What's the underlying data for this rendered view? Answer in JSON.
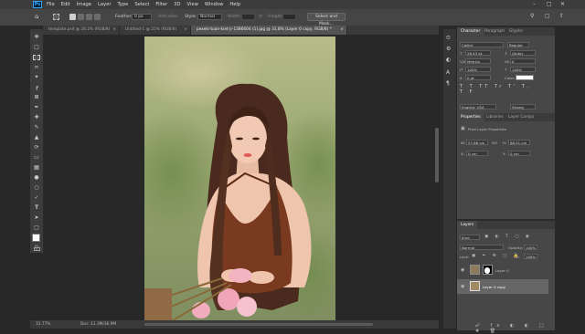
{
  "menu": {
    "items": [
      "File",
      "Edit",
      "Image",
      "Layer",
      "Type",
      "Select",
      "Filter",
      "3D",
      "View",
      "Window",
      "Help"
    ]
  },
  "options_bar": {
    "feather_label": "Feather:",
    "feather_value": "0 px",
    "antialias_label": "Anti-alias",
    "style_label": "Style:",
    "style_value": "Normal",
    "width_label": "Width:",
    "height_label": "Height:",
    "select_mask_label": "Select and Mask..."
  },
  "tabs": [
    {
      "label": "template.psd @ 26.2% (RGB/8)"
    },
    {
      "label": "Untitled-1 @ 25% (RGB/8)"
    },
    {
      "label": "pexels-tuan-kiet-jr-1386604 (1).jpg @ 31.8% (Layer 0 copy, RGB/8) *"
    }
  ],
  "status": {
    "zoom": "31.77%",
    "doc": "Doc: 11.3M/36.9M"
  },
  "character_panel": {
    "tabs": [
      "Character",
      "Paragraph",
      "Glyphs"
    ],
    "font_family": "Calibri",
    "font_style": "Regular",
    "font_size": "26.43 pt",
    "leading": "(Auto)",
    "kerning": "Metrics",
    "tracking": "0",
    "vscale": "100%",
    "hscale": "100%",
    "baseline": "0 pt",
    "color_label": "Color:",
    "language": "English: USA",
    "antialias": "Strong",
    "color": "#ffffff"
  },
  "properties_panel": {
    "tabs": [
      "Properties",
      "Libraries",
      "Layer Comps"
    ],
    "layer_type": "Pixel Layer Properties",
    "w_label": "W:",
    "w_value": "57.68 cm",
    "h_label": "H:",
    "h_value": "86.51 cm",
    "go_label": "GO",
    "x_label": "X:",
    "x_value": "0 cm",
    "y_label": "Y:",
    "y_value": "0 cm"
  },
  "layers_panel": {
    "tab": "Layers",
    "kind": "Kind",
    "blend_mode": "Normal",
    "opacity_label": "Opacity:",
    "opacity_value": "100%",
    "lock_label": "Lock:",
    "fill_label": "Fill:",
    "fill_value": "100%",
    "layers": [
      {
        "name": "Layer 0"
      },
      {
        "name": "Layer 0 copy"
      }
    ]
  },
  "colors": {
    "accent": "#31a8ff",
    "dress": "#7a3a1f"
  }
}
